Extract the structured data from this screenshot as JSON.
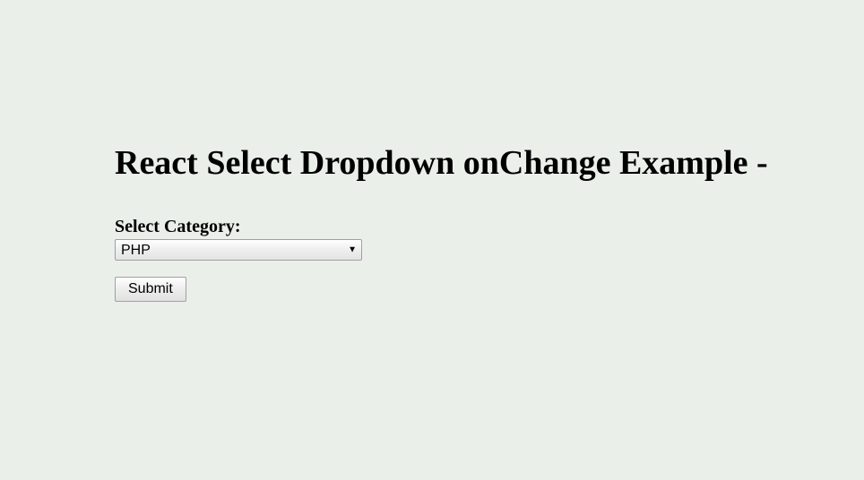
{
  "page": {
    "heading": "React Select Dropdown onChange Example -"
  },
  "form": {
    "category_label": "Select Category:",
    "category_selected": "PHP",
    "submit_label": "Submit"
  }
}
